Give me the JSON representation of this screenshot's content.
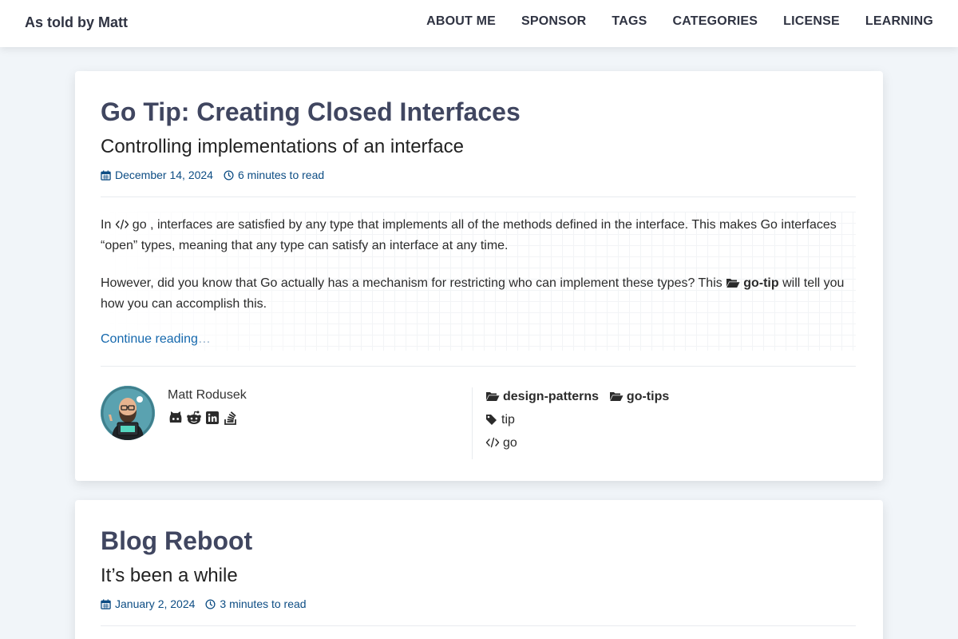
{
  "site": {
    "title": "As told by Matt",
    "nav": [
      "ABOUT ME",
      "SPONSOR",
      "TAGS",
      "CATEGORIES",
      "LICENSE",
      "LEARNING"
    ]
  },
  "posts": [
    {
      "title": "Go Tip: Creating Closed Interfaces",
      "subtitle": "Controlling implementations of an interface",
      "date": "December 14, 2024",
      "read_time": "6 minutes to read",
      "p1_before": "In",
      "p1_code": "go",
      "p1_after": ", interfaces are satisfied by any type that implements all of the methods defined in the interface. This makes Go interfaces “open” types, meaning that any type can satisfy an interface at any time.",
      "p2_before": "However, did you know that Go actually has a mechanism for restricting who can implement these types? This",
      "p2_cat": "go-tip",
      "p2_after": "will tell you how you can accomplish this.",
      "continue": "Continue reading",
      "continue_ellipsis": "…",
      "author": "Matt Rodusek",
      "socials": [
        "github-icon",
        "reddit-icon",
        "linkedin-icon",
        "stackoverflow-icon"
      ],
      "categories": [
        "design-patterns",
        "go-tips"
      ],
      "tags": [
        "tip"
      ],
      "languages": [
        "go"
      ]
    },
    {
      "title": "Blog Reboot",
      "subtitle": "It’s been a while",
      "date": "January 2, 2024",
      "read_time": "3 minutes to read"
    }
  ],
  "colors": {
    "background": "#f1f5f9",
    "title": "#404660",
    "meta": "#0d4d84",
    "link": "#1568ad"
  }
}
